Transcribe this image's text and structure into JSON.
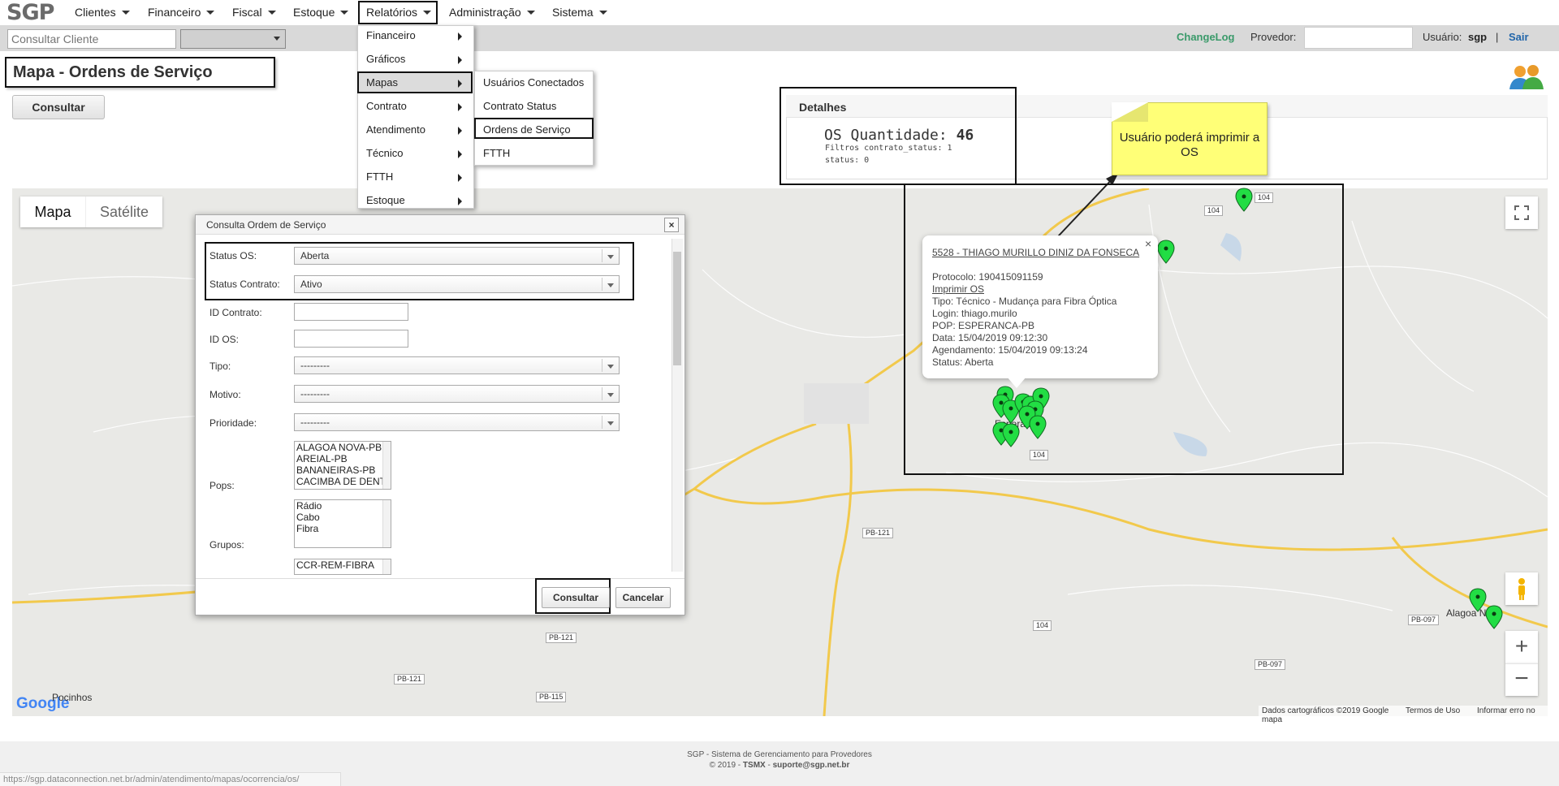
{
  "app": {
    "logo": "SGP"
  },
  "nav": {
    "items": [
      {
        "label": "Clientes"
      },
      {
        "label": "Financeiro"
      },
      {
        "label": "Fiscal"
      },
      {
        "label": "Estoque"
      },
      {
        "label": "Relatórios"
      },
      {
        "label": "Administração"
      },
      {
        "label": "Sistema"
      }
    ]
  },
  "bar2": {
    "search_placeholder": "Consultar Cliente",
    "changelog": "ChangeLog",
    "provedor_label": "Provedor:",
    "usuario_label": "Usuário:",
    "usuario_value": "sgp",
    "separator": "|",
    "sair": "Sair"
  },
  "page": {
    "title": "Mapa - Ordens de Serviço",
    "consultar": "Consultar"
  },
  "detalhes": {
    "title": "Detalhes",
    "os_label": "OS Quantidade:",
    "os_value": "46",
    "filtros": "Filtros contrato_status: 1",
    "status": "status: 0"
  },
  "menus": {
    "relatorios": [
      {
        "label": "Financeiro"
      },
      {
        "label": "Gráficos"
      },
      {
        "label": "Mapas"
      },
      {
        "label": "Contrato"
      },
      {
        "label": "Atendimento"
      },
      {
        "label": "Técnico"
      },
      {
        "label": "FTTH"
      },
      {
        "label": "Estoque"
      }
    ],
    "mapas": [
      {
        "label": "Usuários Conectados"
      },
      {
        "label": "Contrato Status"
      },
      {
        "label": "Ordens de Serviço"
      },
      {
        "label": "FTTH"
      }
    ]
  },
  "map": {
    "tab_mapa": "Mapa",
    "tab_satelite": "Satélite",
    "labels": {
      "city_main": "Esperança",
      "city_left": "Pocinhos",
      "city_right": "Alagoa Nova"
    },
    "roads": {
      "r104": "104",
      "pb121": "PB-121",
      "pb115": "PB-115",
      "pb097": "PB-097"
    },
    "google": "Google",
    "attribution": [
      "Dados cartográficos ©2019 Google",
      "Termos de Uso",
      "Informar erro no mapa"
    ]
  },
  "infowindow": {
    "name": "5528 - THIAGO MURILLO DINIZ DA FONSECA",
    "protocolo": "Protocolo: 190415091159",
    "imprimir": "Imprimir OS",
    "tipo": "Tipo: Técnico - Mudança para Fibra Óptica",
    "login": "Login: thiago.murilo",
    "pop": "POP: ESPERANCA-PB",
    "data": "Data: 15/04/2019 09:12:30",
    "agendamento": "Agendamento: 15/04/2019 09:13:24",
    "status": "Status: Aberta",
    "close": "×"
  },
  "note": {
    "text": "Usuário poderá imprimir a OS"
  },
  "modal": {
    "title": "Consulta Ordem de Serviço",
    "close": "×",
    "status_os_label": "Status OS:",
    "status_os_value": "Aberta",
    "status_contrato_label": "Status Contrato:",
    "status_contrato_value": "Ativo",
    "id_contrato_label": "ID Contrato:",
    "id_os_label": "ID OS:",
    "tipo_label": "Tipo:",
    "tipo_value": "---------",
    "motivo_label": "Motivo:",
    "motivo_value": "---------",
    "prioridade_label": "Prioridade:",
    "prioridade_value": "---------",
    "pops_label": "Pops:",
    "pops": [
      "ALAGOA NOVA-PB",
      "AREIAL-PB",
      "BANANEIRAS-PB",
      "CACIMBA DE DENTRO-PB"
    ],
    "grupos_label": "Grupos:",
    "grupos": [
      "Rádio",
      "Cabo",
      "Fibra"
    ],
    "extra_list": [
      "CCR-REM-FIBRA"
    ],
    "consultar": "Consultar",
    "cancelar": "Cancelar"
  },
  "footer": {
    "line1": "SGP - Sistema de Gerenciamento para Provedores",
    "line2_prefix": "© 2019 - ",
    "line2_company": "TSMX",
    "line2_sep": " - ",
    "line2_email": "suporte@sgp.net.br"
  },
  "statusbar": {
    "url": "https://sgp.dataconnection.net.br/admin/atendimento/mapas/ocorrencia/os/"
  },
  "colors": {
    "marker_green": "#22dd44",
    "accent_blue": "#2266aa",
    "changelog_green": "#3a9a6a",
    "note_yellow": "#ffff77"
  }
}
